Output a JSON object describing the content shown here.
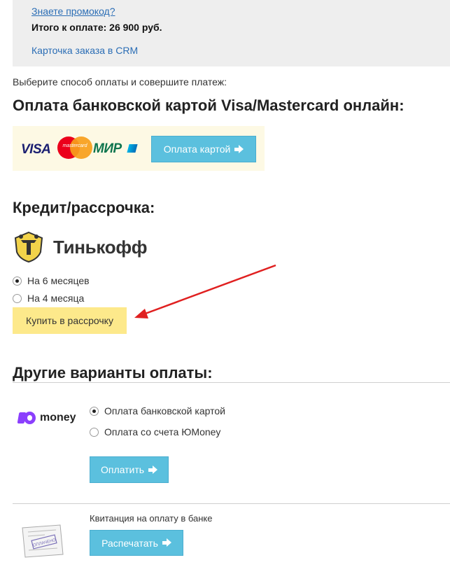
{
  "order_summary": {
    "promo_link": "Знаете промокод?",
    "total": "Итого к оплате: 26 900 руб.",
    "crm_link": "Карточка заказа в CRM"
  },
  "prompt": "Выберите способ оплаты и совершите платеж:",
  "card_payment": {
    "heading": "Оплата банковской картой Visa/Mastercard онлайн:",
    "logos": {
      "visa": "VISA",
      "mastercard": "mastercard",
      "mir": "МИР"
    },
    "button_label": "Оплата картой",
    "button_icon": "arrow-right-icon",
    "button_color": "#5bc0de"
  },
  "credit": {
    "heading": "Кредит/рассрочка:",
    "bank_name": "Тинькофф",
    "options": [
      {
        "label": "На 6 месяцев",
        "selected": true
      },
      {
        "label": "На 4 месяца",
        "selected": false
      }
    ],
    "button_label": "Купить в рассрочку",
    "button_color": "#fde98b"
  },
  "other": {
    "heading": "Другие варианты оплаты:",
    "yoomoney": {
      "brand": "money",
      "options": [
        {
          "label": "Оплата банковской картой",
          "selected": true
        },
        {
          "label": "Оплата со счета ЮMoney",
          "selected": false
        }
      ],
      "button_label": "Оплатить"
    },
    "receipt": {
      "label": "Квитанция на оплату в банке",
      "button_label": "Распечатать",
      "stamp_text": "ОПЛАЧЕНО"
    }
  },
  "annotation": {
    "arrow_color": "#e02020"
  }
}
